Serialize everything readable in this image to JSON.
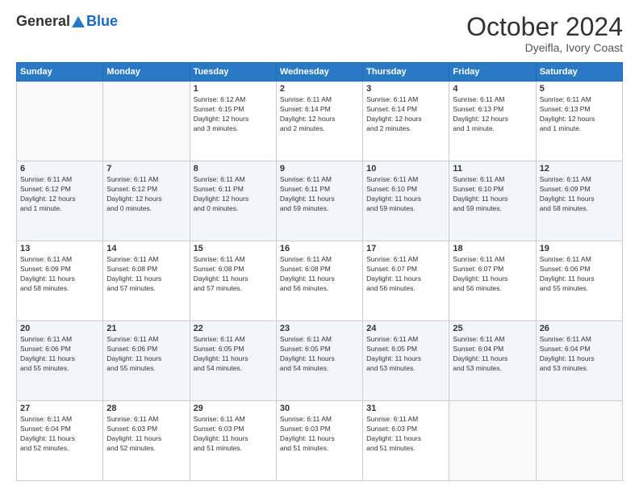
{
  "header": {
    "logo_general": "General",
    "logo_blue": "Blue",
    "month_title": "October 2024",
    "location": "Dyeifla, Ivory Coast"
  },
  "days_of_week": [
    "Sunday",
    "Monday",
    "Tuesday",
    "Wednesday",
    "Thursday",
    "Friday",
    "Saturday"
  ],
  "weeks": [
    [
      {
        "day": "",
        "content": ""
      },
      {
        "day": "",
        "content": ""
      },
      {
        "day": "1",
        "content": "Sunrise: 6:12 AM\nSunset: 6:15 PM\nDaylight: 12 hours\nand 3 minutes."
      },
      {
        "day": "2",
        "content": "Sunrise: 6:11 AM\nSunset: 6:14 PM\nDaylight: 12 hours\nand 2 minutes."
      },
      {
        "day": "3",
        "content": "Sunrise: 6:11 AM\nSunset: 6:14 PM\nDaylight: 12 hours\nand 2 minutes."
      },
      {
        "day": "4",
        "content": "Sunrise: 6:11 AM\nSunset: 6:13 PM\nDaylight: 12 hours\nand 1 minute."
      },
      {
        "day": "5",
        "content": "Sunrise: 6:11 AM\nSunset: 6:13 PM\nDaylight: 12 hours\nand 1 minute."
      }
    ],
    [
      {
        "day": "6",
        "content": "Sunrise: 6:11 AM\nSunset: 6:12 PM\nDaylight: 12 hours\nand 1 minute."
      },
      {
        "day": "7",
        "content": "Sunrise: 6:11 AM\nSunset: 6:12 PM\nDaylight: 12 hours\nand 0 minutes."
      },
      {
        "day": "8",
        "content": "Sunrise: 6:11 AM\nSunset: 6:11 PM\nDaylight: 12 hours\nand 0 minutes."
      },
      {
        "day": "9",
        "content": "Sunrise: 6:11 AM\nSunset: 6:11 PM\nDaylight: 11 hours\nand 59 minutes."
      },
      {
        "day": "10",
        "content": "Sunrise: 6:11 AM\nSunset: 6:10 PM\nDaylight: 11 hours\nand 59 minutes."
      },
      {
        "day": "11",
        "content": "Sunrise: 6:11 AM\nSunset: 6:10 PM\nDaylight: 11 hours\nand 59 minutes."
      },
      {
        "day": "12",
        "content": "Sunrise: 6:11 AM\nSunset: 6:09 PM\nDaylight: 11 hours\nand 58 minutes."
      }
    ],
    [
      {
        "day": "13",
        "content": "Sunrise: 6:11 AM\nSunset: 6:09 PM\nDaylight: 11 hours\nand 58 minutes."
      },
      {
        "day": "14",
        "content": "Sunrise: 6:11 AM\nSunset: 6:08 PM\nDaylight: 11 hours\nand 57 minutes."
      },
      {
        "day": "15",
        "content": "Sunrise: 6:11 AM\nSunset: 6:08 PM\nDaylight: 11 hours\nand 57 minutes."
      },
      {
        "day": "16",
        "content": "Sunrise: 6:11 AM\nSunset: 6:08 PM\nDaylight: 11 hours\nand 56 minutes."
      },
      {
        "day": "17",
        "content": "Sunrise: 6:11 AM\nSunset: 6:07 PM\nDaylight: 11 hours\nand 56 minutes."
      },
      {
        "day": "18",
        "content": "Sunrise: 6:11 AM\nSunset: 6:07 PM\nDaylight: 11 hours\nand 56 minutes."
      },
      {
        "day": "19",
        "content": "Sunrise: 6:11 AM\nSunset: 6:06 PM\nDaylight: 11 hours\nand 55 minutes."
      }
    ],
    [
      {
        "day": "20",
        "content": "Sunrise: 6:11 AM\nSunset: 6:06 PM\nDaylight: 11 hours\nand 55 minutes."
      },
      {
        "day": "21",
        "content": "Sunrise: 6:11 AM\nSunset: 6:06 PM\nDaylight: 11 hours\nand 55 minutes."
      },
      {
        "day": "22",
        "content": "Sunrise: 6:11 AM\nSunset: 6:05 PM\nDaylight: 11 hours\nand 54 minutes."
      },
      {
        "day": "23",
        "content": "Sunrise: 6:11 AM\nSunset: 6:05 PM\nDaylight: 11 hours\nand 54 minutes."
      },
      {
        "day": "24",
        "content": "Sunrise: 6:11 AM\nSunset: 6:05 PM\nDaylight: 11 hours\nand 53 minutes."
      },
      {
        "day": "25",
        "content": "Sunrise: 6:11 AM\nSunset: 6:04 PM\nDaylight: 11 hours\nand 53 minutes."
      },
      {
        "day": "26",
        "content": "Sunrise: 6:11 AM\nSunset: 6:04 PM\nDaylight: 11 hours\nand 53 minutes."
      }
    ],
    [
      {
        "day": "27",
        "content": "Sunrise: 6:11 AM\nSunset: 6:04 PM\nDaylight: 11 hours\nand 52 minutes."
      },
      {
        "day": "28",
        "content": "Sunrise: 6:11 AM\nSunset: 6:03 PM\nDaylight: 11 hours\nand 52 minutes."
      },
      {
        "day": "29",
        "content": "Sunrise: 6:11 AM\nSunset: 6:03 PM\nDaylight: 11 hours\nand 51 minutes."
      },
      {
        "day": "30",
        "content": "Sunrise: 6:11 AM\nSunset: 6:03 PM\nDaylight: 11 hours\nand 51 minutes."
      },
      {
        "day": "31",
        "content": "Sunrise: 6:11 AM\nSunset: 6:03 PM\nDaylight: 11 hours\nand 51 minutes."
      },
      {
        "day": "",
        "content": ""
      },
      {
        "day": "",
        "content": ""
      }
    ]
  ]
}
